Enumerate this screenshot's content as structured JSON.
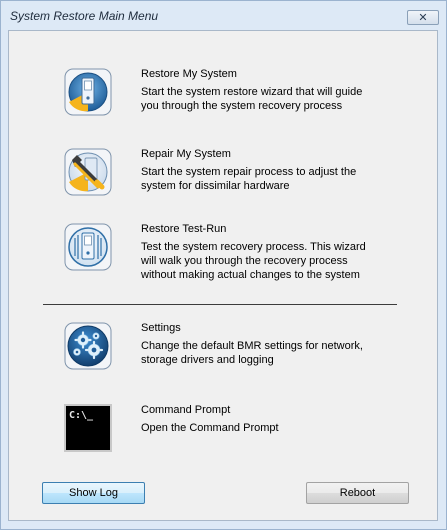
{
  "window": {
    "title": "System Restore Main Menu",
    "close_glyph": "✕"
  },
  "menu": {
    "items": [
      {
        "icon": "restore-system-icon",
        "title": "Restore My System",
        "description": "Start the system restore wizard that will guide you through the system recovery process"
      },
      {
        "icon": "repair-wrench-icon",
        "title": "Repair My System",
        "description": "Start the system repair process to adjust the system for dissimilar hardware"
      },
      {
        "icon": "test-run-icon",
        "title": "Restore Test-Run",
        "description": "Test the system recovery process. This wizard will walk you through the recovery process without making actual changes to the system"
      },
      {
        "icon": "settings-gears-icon",
        "title": "Settings",
        "description": "Change the default BMR settings for network, storage drivers and logging"
      },
      {
        "icon": "command-prompt-icon",
        "icon_text": "C:\\_",
        "title": "Command Prompt",
        "description": "Open the Command Prompt"
      }
    ]
  },
  "buttons": {
    "show_log": "Show Log",
    "reboot": "Reboot"
  },
  "colors": {
    "window_frame": "#dde9f6",
    "client_background": "#f0f0f0",
    "default_button_border": "#3c7fb1",
    "icon_blue": "#2f6fa7",
    "icon_yellow": "#f5b41c"
  }
}
